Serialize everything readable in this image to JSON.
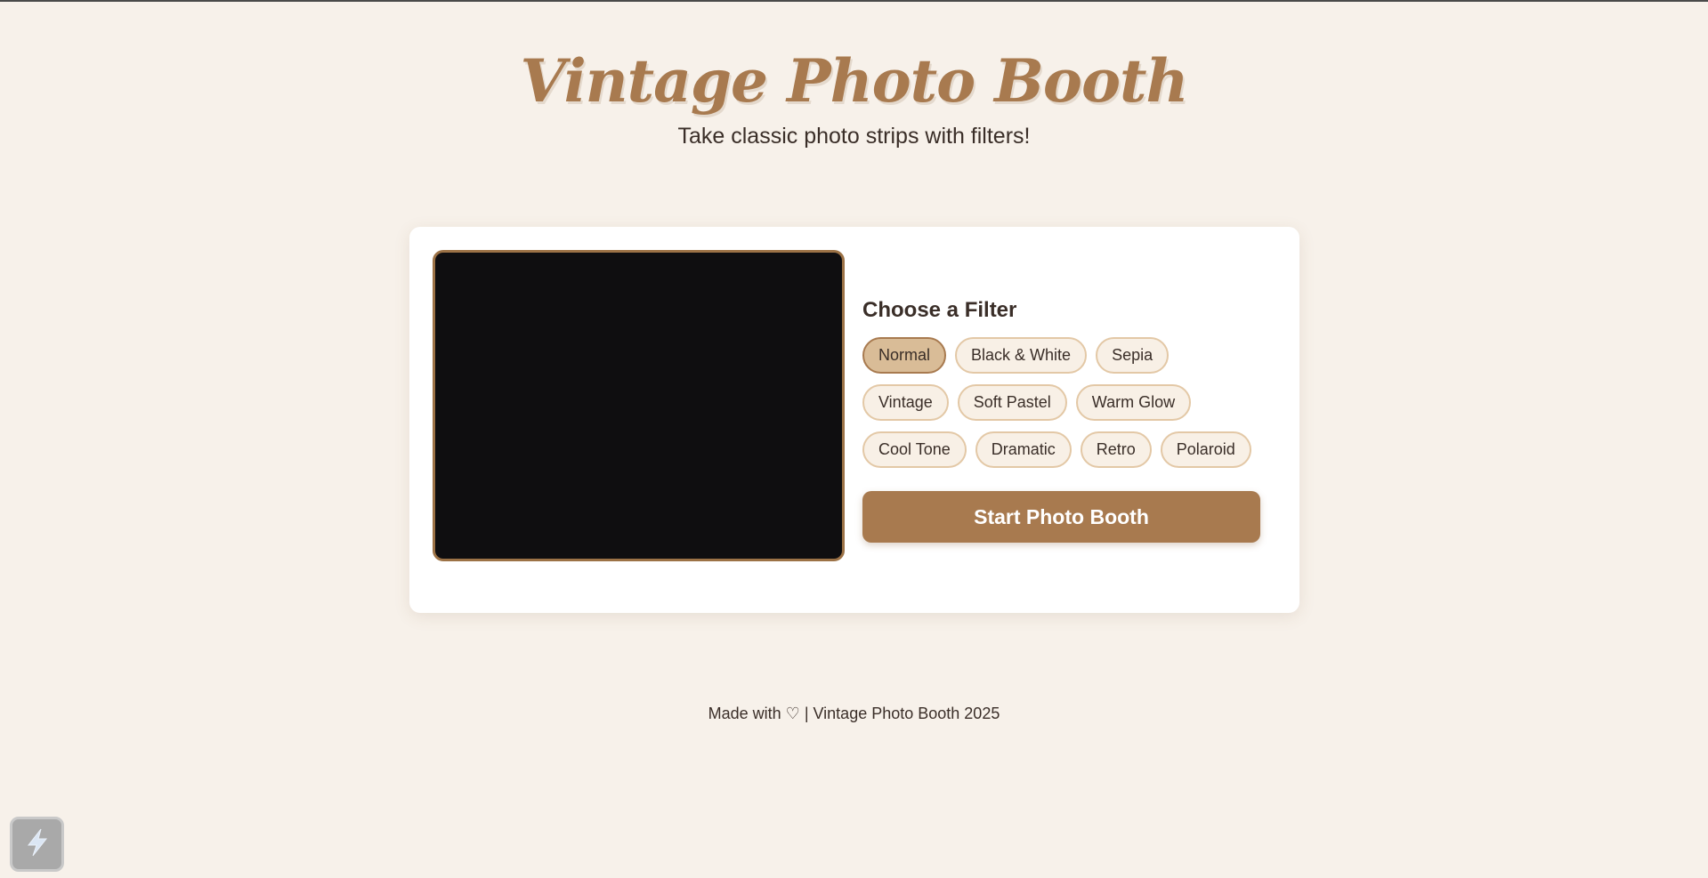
{
  "header": {
    "title": "Vintage Photo Booth",
    "subtitle": "Take classic photo strips with filters!"
  },
  "filters": {
    "heading": "Choose a Filter",
    "rows": [
      [
        "Normal",
        "Black & White",
        "Sepia"
      ],
      [
        "Vintage",
        "Soft Pastel",
        "Warm Glow"
      ],
      [
        "Cool Tone",
        "Dramatic",
        "Retro",
        "Polaroid"
      ]
    ],
    "selected": "Normal"
  },
  "start_button": {
    "label": "Start Photo Booth"
  },
  "footer": {
    "text": "Made with ♡ | Vintage Photo Booth 2025"
  },
  "widget": {
    "icon": "lightning-icon"
  },
  "colors": {
    "accent": "#a87a4f",
    "background": "#f7f1ea",
    "chip_border": "#e3c8a6",
    "chip_active": "#d9bc97",
    "preview_bg": "#0f0e10"
  }
}
